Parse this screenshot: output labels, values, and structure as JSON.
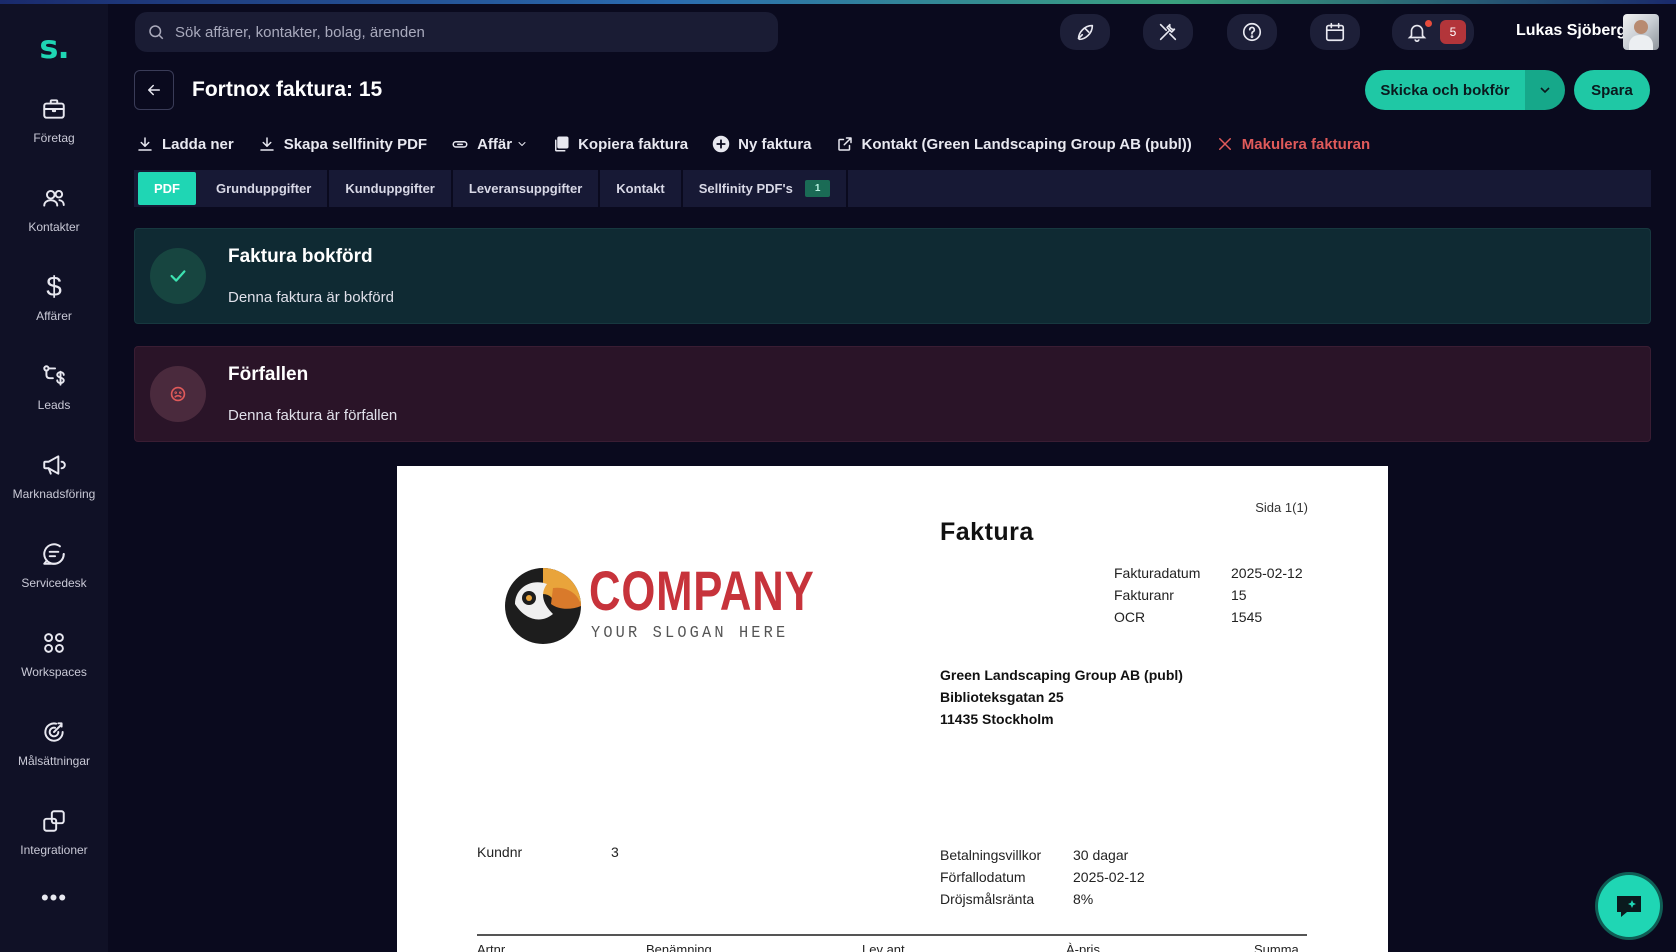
{
  "app": {
    "logo": "s."
  },
  "sidebar": {
    "items": [
      {
        "label": "Företag",
        "icon": "briefcase-icon"
      },
      {
        "label": "Kontakter",
        "icon": "users-icon"
      },
      {
        "label": "Affärer",
        "icon": "dollar-icon"
      },
      {
        "label": "Leads",
        "icon": "leads-icon"
      },
      {
        "label": "Marknadsföring",
        "icon": "megaphone-icon"
      },
      {
        "label": "Servicedesk",
        "icon": "chat-search-icon"
      },
      {
        "label": "Workspaces",
        "icon": "grid-circles-icon"
      },
      {
        "label": "Målsättningar",
        "icon": "target-icon"
      },
      {
        "label": "Integrationer",
        "icon": "integrations-icon"
      }
    ],
    "more": "•••"
  },
  "header": {
    "search_placeholder": "Sök affärer, kontakter, bolag, ärenden",
    "notifications_count": "5",
    "user_name": "Lukas Sjöberg"
  },
  "page": {
    "title": "Fortnox faktura: 15",
    "primary_action": "Skicka och bokför",
    "save_label": "Spara"
  },
  "actions": {
    "download": "Ladda ner",
    "create_pdf": "Skapa sellfinity PDF",
    "deal": "Affär",
    "copy": "Kopiera faktura",
    "new": "Ny faktura",
    "contact": "Kontakt (Green Landscaping Group AB (publ))",
    "void": "Makulera fakturan"
  },
  "tabs": [
    {
      "label": "PDF"
    },
    {
      "label": "Grunduppgifter"
    },
    {
      "label": "Kunduppgifter"
    },
    {
      "label": "Leveransuppgifter"
    },
    {
      "label": "Kontakt"
    },
    {
      "label": "Sellfinity PDF's",
      "count": "1"
    }
  ],
  "status": {
    "booked_title": "Faktura bokförd",
    "booked_text": "Denna faktura är bokförd",
    "overdue_title": "Förfallen",
    "overdue_text": "Denna faktura är förfallen"
  },
  "invoice": {
    "page": "Sida 1(1)",
    "title": "Faktura",
    "logo_text": "COMPANY",
    "logo_slogan": "YOUR SLOGAN HERE",
    "meta": [
      {
        "k": "Fakturadatum",
        "v": "2025-02-12"
      },
      {
        "k": "Fakturanr",
        "v": "15"
      },
      {
        "k": "OCR",
        "v": "1545"
      }
    ],
    "address": [
      "Green Landscaping Group AB (publ)",
      "Biblioteksgatan 25",
      "11435 Stockholm"
    ],
    "kundnr_label": "Kundnr",
    "kundnr_value": "3",
    "terms": [
      {
        "k": "Betalningsvillkor",
        "v": "30 dagar"
      },
      {
        "k": "Förfallodatum",
        "v": "2025-02-12"
      },
      {
        "k": "Dröjsmålsränta",
        "v": "8%"
      }
    ],
    "columns": [
      "Artnr",
      "Benämning",
      "Lev ant",
      "À-pris",
      "Summa"
    ]
  },
  "colors": {
    "accent": "#1fd6b4",
    "background": "#0a0a1e",
    "sidebar": "#101126",
    "danger": "#e05a5a"
  }
}
